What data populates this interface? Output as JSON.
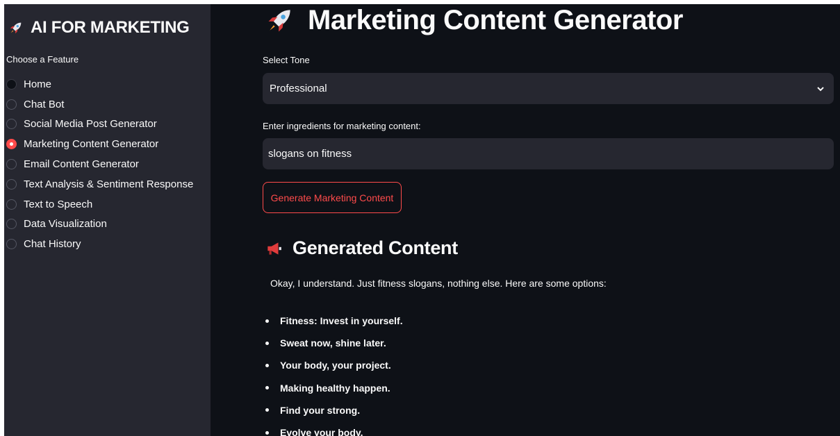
{
  "sidebar": {
    "title": "AI FOR MARKETING",
    "title_icon": "rocket-icon",
    "feature_label": "Choose a Feature",
    "items": [
      {
        "label": "Home",
        "state": "dark"
      },
      {
        "label": "Chat Bot",
        "state": "unselected"
      },
      {
        "label": "Social Media Post Generator",
        "state": "unselected"
      },
      {
        "label": "Marketing Content Generator",
        "state": "selected"
      },
      {
        "label": "Email Content Generator",
        "state": "unselected"
      },
      {
        "label": "Text Analysis & Sentiment Response",
        "state": "unselected"
      },
      {
        "label": "Text to Speech",
        "state": "unselected"
      },
      {
        "label": "Data Visualization",
        "state": "unselected"
      },
      {
        "label": "Chat History",
        "state": "unselected"
      }
    ]
  },
  "main": {
    "title": "Marketing Content Generator",
    "title_icon": "rocket-icon",
    "tone_label": "Select Tone",
    "tone_value": "Professional",
    "ingredients_label": "Enter ingredients for marketing content:",
    "ingredients_value": "slogans on fitness",
    "generate_button": "Generate Marketing Content",
    "generated_heading": "Generated Content",
    "generated_icon": "megaphone-icon",
    "intro": "Okay, I understand. Just fitness slogans, nothing else. Here are some options:",
    "slogans": [
      "Fitness: Invest in yourself.",
      "Sweat now, shine later.",
      "Your body, your project.",
      "Making healthy happen.",
      "Find your strong.",
      "Evolve your body."
    ]
  },
  "colors": {
    "sidebar_bg": "#262730",
    "main_bg": "#0e1117",
    "accent": "#ff4b4b",
    "text": "#fafafa"
  }
}
